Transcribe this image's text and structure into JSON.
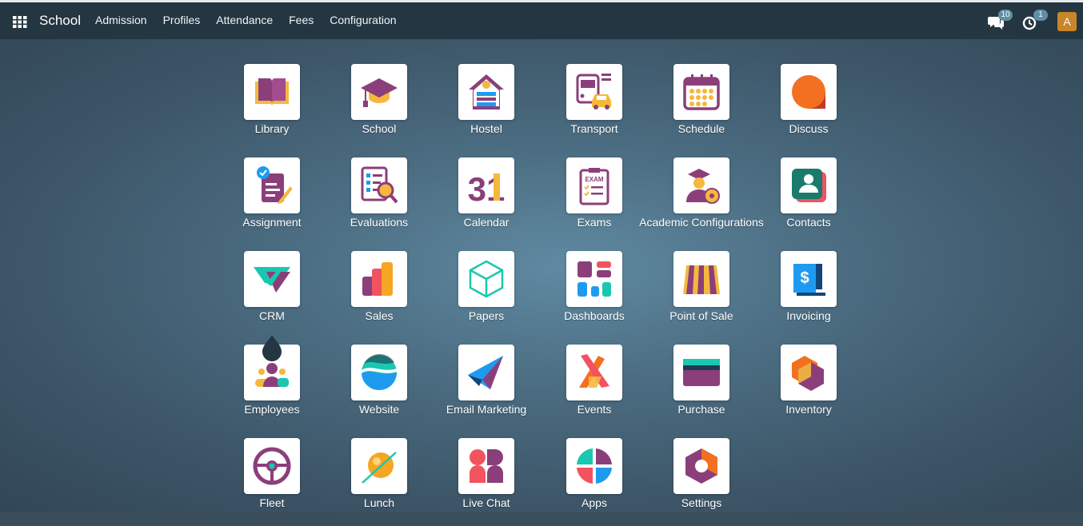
{
  "navbar": {
    "brand": "School",
    "menu": [
      "Admission",
      "Profiles",
      "Attendance",
      "Fees",
      "Configuration"
    ],
    "chat_count": "10",
    "activity_count": "1",
    "avatar_letter": "A"
  },
  "apps": [
    {
      "label": "Library",
      "icon": "library-icon"
    },
    {
      "label": "School",
      "icon": "school-icon"
    },
    {
      "label": "Hostel",
      "icon": "hostel-icon"
    },
    {
      "label": "Transport",
      "icon": "transport-icon"
    },
    {
      "label": "Schedule",
      "icon": "schedule-icon"
    },
    {
      "label": "Discuss",
      "icon": "discuss-icon"
    },
    {
      "label": "Assignment",
      "icon": "assignment-icon"
    },
    {
      "label": "Evaluations",
      "icon": "evaluations-icon"
    },
    {
      "label": "Calendar",
      "icon": "calendar-icon"
    },
    {
      "label": "Exams",
      "icon": "exams-icon"
    },
    {
      "label": "Academic Configurations",
      "icon": "academic-config-icon"
    },
    {
      "label": "Contacts",
      "icon": "contacts-icon"
    },
    {
      "label": "CRM",
      "icon": "crm-icon"
    },
    {
      "label": "Sales",
      "icon": "sales-icon"
    },
    {
      "label": "Papers",
      "icon": "papers-icon"
    },
    {
      "label": "Dashboards",
      "icon": "dashboards-icon"
    },
    {
      "label": "Point of Sale",
      "icon": "pos-icon"
    },
    {
      "label": "Invoicing",
      "icon": "invoicing-icon"
    },
    {
      "label": "Employees",
      "icon": "employees-icon"
    },
    {
      "label": "Website",
      "icon": "website-icon"
    },
    {
      "label": "Email Marketing",
      "icon": "email-marketing-icon"
    },
    {
      "label": "Events",
      "icon": "events-icon"
    },
    {
      "label": "Purchase",
      "icon": "purchase-icon"
    },
    {
      "label": "Inventory",
      "icon": "inventory-icon"
    },
    {
      "label": "Fleet",
      "icon": "fleet-icon"
    },
    {
      "label": "Lunch",
      "icon": "lunch-icon"
    },
    {
      "label": "Live Chat",
      "icon": "live-chat-icon"
    },
    {
      "label": "Apps",
      "icon": "apps-icon"
    },
    {
      "label": "Settings",
      "icon": "settings-icon"
    }
  ],
  "icon_text": {
    "calendar_number": "31",
    "exams_text": "EXAM",
    "invoicing_symbol": "$"
  },
  "colors": {
    "navbar": "#243642",
    "purple": "#8b3f7a",
    "orange": "#f5a623",
    "teal": "#1ac7b0",
    "red": "#f1535f",
    "blue": "#1e9bf0"
  }
}
